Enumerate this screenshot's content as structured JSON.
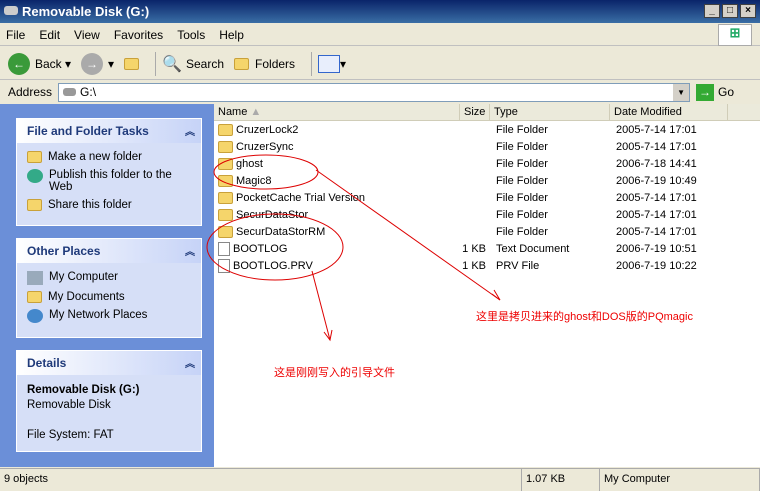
{
  "window": {
    "title": "Removable Disk (G:)"
  },
  "menu": [
    "File",
    "Edit",
    "View",
    "Favorites",
    "Tools",
    "Help"
  ],
  "toolbar": {
    "back": "Back",
    "search": "Search",
    "folders": "Folders"
  },
  "address": {
    "label": "Address",
    "value": "G:\\",
    "go": "Go"
  },
  "tasks": {
    "title": "File and Folder Tasks",
    "items": [
      "Make a new folder",
      "Publish this folder to the Web",
      "Share this folder"
    ]
  },
  "places": {
    "title": "Other Places",
    "items": [
      "My Computer",
      "My Documents",
      "My Network Places"
    ]
  },
  "details": {
    "title": "Details",
    "name": "Removable Disk (G:)",
    "type": "Removable Disk",
    "fs": "File System: FAT"
  },
  "columns": [
    "Name",
    "Size",
    "Type",
    "Date Modified"
  ],
  "files": [
    {
      "name": "CruzerLock2",
      "size": "",
      "type": "File Folder",
      "date": "2005-7-14 17:01",
      "kind": "folder"
    },
    {
      "name": "CruzerSync",
      "size": "",
      "type": "File Folder",
      "date": "2005-7-14 17:01",
      "kind": "folder"
    },
    {
      "name": "ghost",
      "size": "",
      "type": "File Folder",
      "date": "2006-7-18 14:41",
      "kind": "folder"
    },
    {
      "name": "Magic8",
      "size": "",
      "type": "File Folder",
      "date": "2006-7-19 10:49",
      "kind": "folder"
    },
    {
      "name": "PocketCache Trial Version",
      "size": "",
      "type": "File Folder",
      "date": "2005-7-14 17:01",
      "kind": "folder"
    },
    {
      "name": "SecurDataStor",
      "size": "",
      "type": "File Folder",
      "date": "2005-7-14 17:01",
      "kind": "folder"
    },
    {
      "name": "SecurDataStorRM",
      "size": "",
      "type": "File Folder",
      "date": "2005-7-14 17:01",
      "kind": "folder"
    },
    {
      "name": "BOOTLOG",
      "size": "1 KB",
      "type": "Text Document",
      "date": "2006-7-19 10:51",
      "kind": "doc"
    },
    {
      "name": "BOOTLOG.PRV",
      "size": "1 KB",
      "type": "PRV File",
      "date": "2006-7-19 10:22",
      "kind": "doc"
    }
  ],
  "annotations": {
    "right": "这里是拷贝进来的ghost和DOS版的PQmagic",
    "left": "这是刚刚写入的引导文件"
  },
  "status": {
    "objects": "9 objects",
    "size": "1.07 KB",
    "location": "My Computer"
  }
}
